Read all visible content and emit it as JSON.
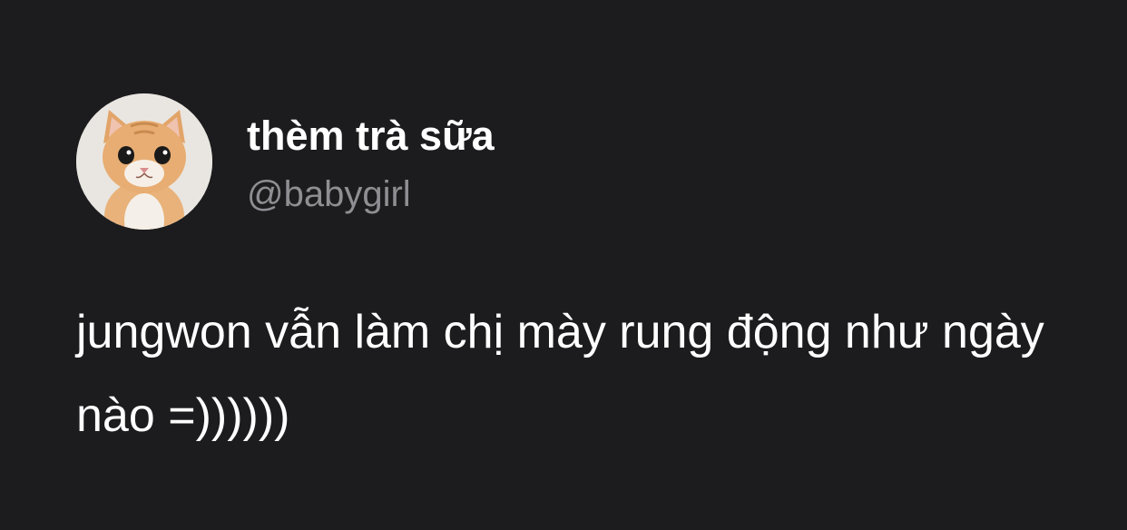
{
  "tweet": {
    "author": {
      "display_name": "thèm trà sữa",
      "handle": "@babygirl",
      "avatar_icon": "kitten-avatar"
    },
    "text": "jungwon vẫn làm chị mày rung động như ngày nào =))))))"
  },
  "colors": {
    "background": "#1c1c1e",
    "primary_text": "#ffffff",
    "secondary_text": "#8e8e93"
  }
}
